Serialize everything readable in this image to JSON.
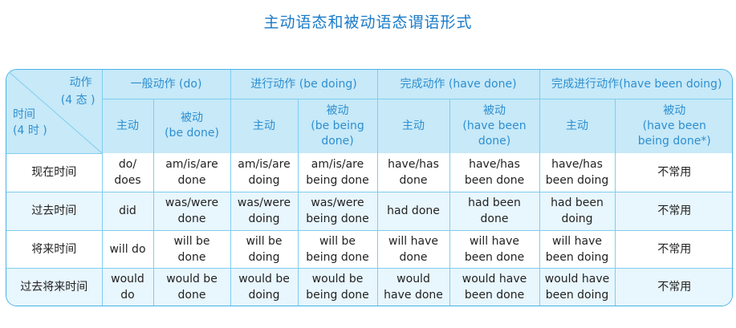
{
  "title": "主动语态和被动语态谓语形式",
  "corner": {
    "dongzuo": "动作",
    "state_count": "(4 态 )",
    "shijian": "时间",
    "time_count": "(4 时 )"
  },
  "groups": [
    {
      "label": "一般动作 (do)"
    },
    {
      "label": "进行动作 (be doing)"
    },
    {
      "label": "完成动作 (have done)"
    },
    {
      "label": "完成进行动作(have been doing)"
    }
  ],
  "sub_headers": [
    [
      "主动"
    ],
    [
      "被动",
      "(be done)"
    ],
    [
      "主动"
    ],
    [
      "被动",
      "(be being",
      "done)"
    ],
    [
      "主动"
    ],
    [
      "被动",
      "(have been",
      "done)"
    ],
    [
      "主动"
    ],
    [
      "被动",
      "(have been",
      "being done*)"
    ]
  ],
  "rows": [
    {
      "label": "现在时间",
      "cells": [
        [
          "do/",
          "does"
        ],
        [
          "am/is/are",
          "done"
        ],
        [
          "am/is/are",
          "doing"
        ],
        [
          "am/is/are",
          "being done"
        ],
        [
          "have/has",
          "done"
        ],
        [
          "have/has",
          "been done"
        ],
        [
          "have/has",
          "been doing"
        ],
        [
          "不常用"
        ]
      ]
    },
    {
      "label": "过去时间",
      "cells": [
        [
          "did"
        ],
        [
          "was/were",
          "done"
        ],
        [
          "was/were",
          "doing"
        ],
        [
          "was/were",
          "being done"
        ],
        [
          "had done"
        ],
        [
          "had been",
          "done"
        ],
        [
          "had been",
          "doing"
        ],
        [
          "不常用"
        ]
      ]
    },
    {
      "label": "将来时间",
      "cells": [
        [
          "will do"
        ],
        [
          "will be",
          "done"
        ],
        [
          "will be",
          "doing"
        ],
        [
          "will be",
          "being done"
        ],
        [
          "will have",
          "done"
        ],
        [
          "will have",
          "been done"
        ],
        [
          "will have",
          "been doing"
        ],
        [
          "不常用"
        ]
      ]
    },
    {
      "label": "过去将来时间",
      "cells": [
        [
          "would",
          "do"
        ],
        [
          "would be",
          "done"
        ],
        [
          "would be",
          "doing"
        ],
        [
          "would be",
          "being done"
        ],
        [
          "would",
          "have done"
        ],
        [
          "would have",
          "been done"
        ],
        [
          "would have",
          "been doing"
        ],
        [
          "不常用"
        ]
      ]
    }
  ],
  "colors": {
    "title": "#1a7bc9",
    "header_bg": "#c7e9f8",
    "header_text": "#2e8fd0",
    "border": "#7fcdf0",
    "stripe": "#e8f6fd"
  }
}
